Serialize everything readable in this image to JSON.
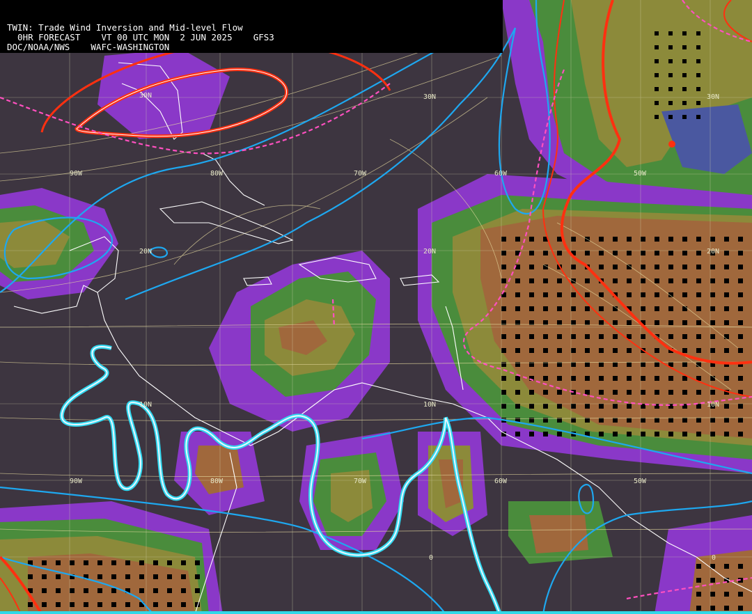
{
  "header": {
    "line1": "TWIN: Trade Wind Inversion and Mid-level Flow",
    "line2": "  0HR FORECAST    VT 00 UTC MON  2 JUN 2025    GFS3",
    "line3": "DOC/NOAA/NWS    WAFC-WASHINGTON"
  },
  "grid_labels": {
    "lat_30n_a": "30N",
    "lat_30n_b": "30N",
    "lat_20n_a": "20N",
    "lat_20n_b": "20N",
    "lat_20n_c": "20N",
    "lat_10n_a": "10N",
    "lat_10n_b": "10N",
    "lat_10n_c": "10N",
    "lon_90w_a": "90W",
    "lon_80w_a": "80W",
    "lon_70w_a": "70W",
    "lon_60w_a": "60W",
    "lon_50w_a": "50W",
    "lon_90w_b": "90W",
    "lon_80w_b": "80W",
    "lon_70w_b": "70W",
    "lon_60w_b": "60W",
    "lon_50w_b": "50W",
    "eq_a": "0",
    "eq_b": "0"
  },
  "colors": {
    "background": "#3d3540",
    "purple": "#8a38c8",
    "blue_band": "#4a58a0",
    "green": "#4a8c3c",
    "olive": "#8c8a3a",
    "tan": "#a0683c",
    "cyan_contour": "#1ea8f0",
    "red_contour": "#ff3010",
    "pink_dash": "#ff50c0",
    "wind": "#e8dca0",
    "coast": "#ffffff"
  }
}
